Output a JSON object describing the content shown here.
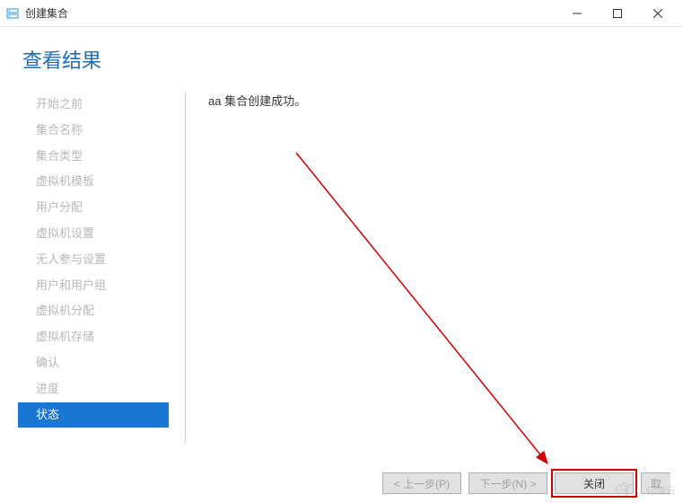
{
  "window": {
    "title": "创建集合",
    "icon": "server-stack-icon"
  },
  "page": {
    "heading": "查看结果"
  },
  "sidebar": {
    "items": [
      {
        "label": "开始之前",
        "active": false
      },
      {
        "label": "集合名称",
        "active": false
      },
      {
        "label": "集合类型",
        "active": false
      },
      {
        "label": "虚拟机模板",
        "active": false
      },
      {
        "label": "用户分配",
        "active": false
      },
      {
        "label": "虚拟机设置",
        "active": false
      },
      {
        "label": "无人参与设置",
        "active": false
      },
      {
        "label": "用户和用户组",
        "active": false
      },
      {
        "label": "虚拟机分配",
        "active": false
      },
      {
        "label": "虚拟机存储",
        "active": false
      },
      {
        "label": "确认",
        "active": false
      },
      {
        "label": "进度",
        "active": false
      },
      {
        "label": "状态",
        "active": true
      }
    ]
  },
  "result": {
    "message": "aa 集合创建成功。"
  },
  "buttons": {
    "prev": "< 上一步(P)",
    "next": "下一步(N) >",
    "close": "关闭",
    "cancel": "取"
  },
  "watermark": {
    "text": "亿速云"
  }
}
